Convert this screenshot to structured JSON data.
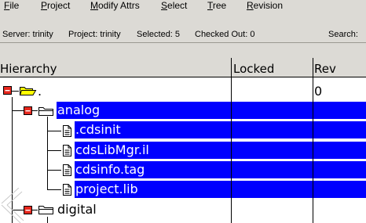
{
  "menu": {
    "file": {
      "mnemonic": "F",
      "rest": "ile"
    },
    "project": {
      "mnemonic": "P",
      "rest": "roject"
    },
    "modify_attrs": {
      "mnemonic": "M",
      "rest": "odify Attrs"
    },
    "select": {
      "mnemonic": "S",
      "rest": "elect"
    },
    "tree": {
      "mnemonic": "T",
      "rest": "ree"
    },
    "revision": {
      "mnemonic": "R",
      "rest": "evision"
    }
  },
  "status": {
    "server": "Server: trinity",
    "project": "Project: trinity",
    "selected": "Selected: 5",
    "checked_out": "Checked Out: 0",
    "search": "Search:"
  },
  "columns": {
    "hierarchy": "Hierarchy",
    "locked": "Locked",
    "rev": "Rev"
  },
  "rows": [
    {
      "label": ".",
      "type": "folder-open",
      "selected": false,
      "rev": "0"
    },
    {
      "label": "analog",
      "type": "folder",
      "selected": true,
      "rev": ""
    },
    {
      "label": ".cdsinit",
      "type": "file",
      "selected": true,
      "rev": ""
    },
    {
      "label": "cdsLibMgr.il",
      "type": "file",
      "selected": true,
      "rev": ""
    },
    {
      "label": "cdsinfo.tag",
      "type": "file",
      "selected": true,
      "rev": ""
    },
    {
      "label": "project.lib",
      "type": "file",
      "selected": true,
      "rev": ""
    },
    {
      "label": "digital",
      "type": "folder",
      "selected": false,
      "rev": ""
    }
  ],
  "colors": {
    "selection": "#0000ff",
    "folder_fill": "#ffff00",
    "expander": "#e8281e",
    "window_bg": "#dcdad5"
  }
}
